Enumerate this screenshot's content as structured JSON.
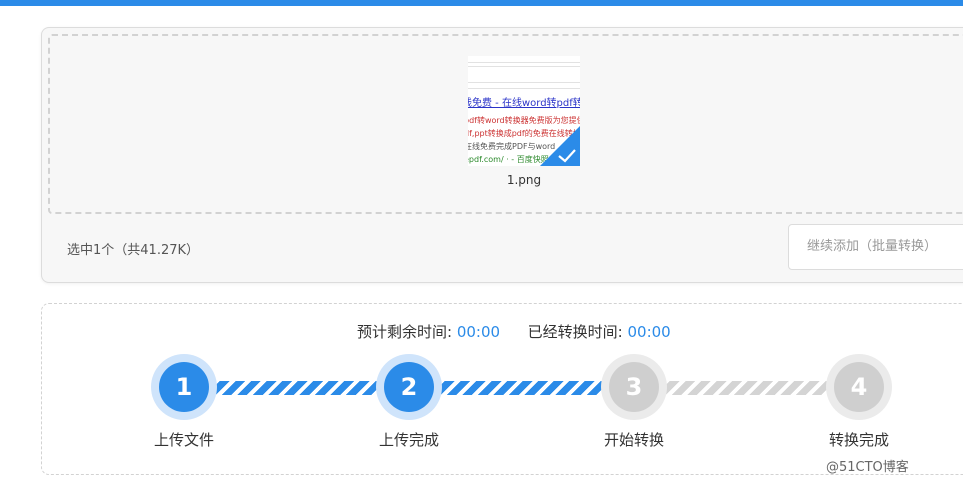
{
  "upload": {
    "thumbnail": {
      "lines": [
        "线免费 - 在线word转pdf转换",
        "pdf转word转换器免费版为您提供",
        "df,ppt转换成pdf的免费在线转换",
        "在线免费完成PDF与word",
        "epdf.com/ · - 百度快照"
      ],
      "selected": true
    },
    "file_name": "1.png",
    "selection_summary": "选中1个（共41.27K）",
    "continue_button": "继续添加（批量转换）"
  },
  "progress": {
    "remaining_label": "预计剩余时间:",
    "remaining_value": "00:00",
    "elapsed_label": "已经转换时间:",
    "elapsed_value": "00:00",
    "steps": [
      {
        "number": "1",
        "label": "上传文件",
        "state": "done"
      },
      {
        "number": "2",
        "label": "上传完成",
        "state": "done"
      },
      {
        "number": "3",
        "label": "开始转换",
        "state": "todo"
      },
      {
        "number": "4",
        "label": "转换完成",
        "state": "todo"
      }
    ]
  },
  "watermark": "@51CTO博客",
  "colors": {
    "accent": "#2b8be8",
    "inactive": "#cfcfcf"
  }
}
